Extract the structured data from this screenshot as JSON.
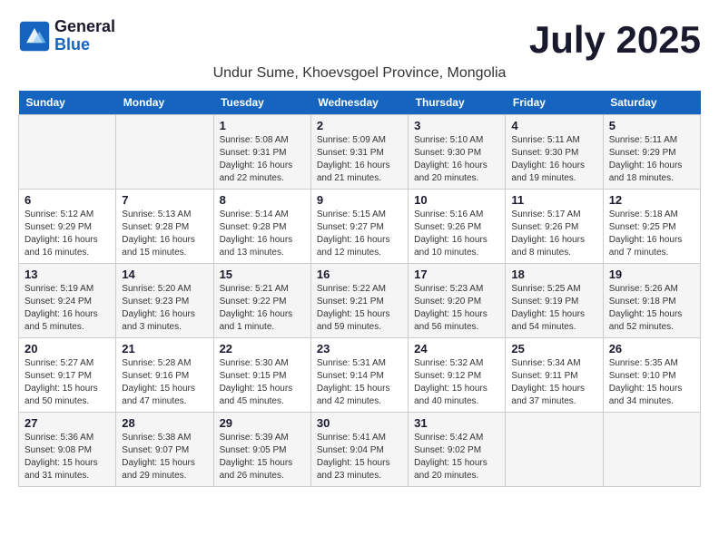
{
  "logo": {
    "line1": "General",
    "line2": "Blue"
  },
  "title": "July 2025",
  "subtitle": "Undur Sume, Khoevsgoel Province, Mongolia",
  "weekdays": [
    "Sunday",
    "Monday",
    "Tuesday",
    "Wednesday",
    "Thursday",
    "Friday",
    "Saturday"
  ],
  "weeks": [
    [
      {
        "day": "",
        "info": ""
      },
      {
        "day": "",
        "info": ""
      },
      {
        "day": "1",
        "info": "Sunrise: 5:08 AM\nSunset: 9:31 PM\nDaylight: 16 hours and 22 minutes."
      },
      {
        "day": "2",
        "info": "Sunrise: 5:09 AM\nSunset: 9:31 PM\nDaylight: 16 hours and 21 minutes."
      },
      {
        "day": "3",
        "info": "Sunrise: 5:10 AM\nSunset: 9:30 PM\nDaylight: 16 hours and 20 minutes."
      },
      {
        "day": "4",
        "info": "Sunrise: 5:11 AM\nSunset: 9:30 PM\nDaylight: 16 hours and 19 minutes."
      },
      {
        "day": "5",
        "info": "Sunrise: 5:11 AM\nSunset: 9:29 PM\nDaylight: 16 hours and 18 minutes."
      }
    ],
    [
      {
        "day": "6",
        "info": "Sunrise: 5:12 AM\nSunset: 9:29 PM\nDaylight: 16 hours and 16 minutes."
      },
      {
        "day": "7",
        "info": "Sunrise: 5:13 AM\nSunset: 9:28 PM\nDaylight: 16 hours and 15 minutes."
      },
      {
        "day": "8",
        "info": "Sunrise: 5:14 AM\nSunset: 9:28 PM\nDaylight: 16 hours and 13 minutes."
      },
      {
        "day": "9",
        "info": "Sunrise: 5:15 AM\nSunset: 9:27 PM\nDaylight: 16 hours and 12 minutes."
      },
      {
        "day": "10",
        "info": "Sunrise: 5:16 AM\nSunset: 9:26 PM\nDaylight: 16 hours and 10 minutes."
      },
      {
        "day": "11",
        "info": "Sunrise: 5:17 AM\nSunset: 9:26 PM\nDaylight: 16 hours and 8 minutes."
      },
      {
        "day": "12",
        "info": "Sunrise: 5:18 AM\nSunset: 9:25 PM\nDaylight: 16 hours and 7 minutes."
      }
    ],
    [
      {
        "day": "13",
        "info": "Sunrise: 5:19 AM\nSunset: 9:24 PM\nDaylight: 16 hours and 5 minutes."
      },
      {
        "day": "14",
        "info": "Sunrise: 5:20 AM\nSunset: 9:23 PM\nDaylight: 16 hours and 3 minutes."
      },
      {
        "day": "15",
        "info": "Sunrise: 5:21 AM\nSunset: 9:22 PM\nDaylight: 16 hours and 1 minute."
      },
      {
        "day": "16",
        "info": "Sunrise: 5:22 AM\nSunset: 9:21 PM\nDaylight: 15 hours and 59 minutes."
      },
      {
        "day": "17",
        "info": "Sunrise: 5:23 AM\nSunset: 9:20 PM\nDaylight: 15 hours and 56 minutes."
      },
      {
        "day": "18",
        "info": "Sunrise: 5:25 AM\nSunset: 9:19 PM\nDaylight: 15 hours and 54 minutes."
      },
      {
        "day": "19",
        "info": "Sunrise: 5:26 AM\nSunset: 9:18 PM\nDaylight: 15 hours and 52 minutes."
      }
    ],
    [
      {
        "day": "20",
        "info": "Sunrise: 5:27 AM\nSunset: 9:17 PM\nDaylight: 15 hours and 50 minutes."
      },
      {
        "day": "21",
        "info": "Sunrise: 5:28 AM\nSunset: 9:16 PM\nDaylight: 15 hours and 47 minutes."
      },
      {
        "day": "22",
        "info": "Sunrise: 5:30 AM\nSunset: 9:15 PM\nDaylight: 15 hours and 45 minutes."
      },
      {
        "day": "23",
        "info": "Sunrise: 5:31 AM\nSunset: 9:14 PM\nDaylight: 15 hours and 42 minutes."
      },
      {
        "day": "24",
        "info": "Sunrise: 5:32 AM\nSunset: 9:12 PM\nDaylight: 15 hours and 40 minutes."
      },
      {
        "day": "25",
        "info": "Sunrise: 5:34 AM\nSunset: 9:11 PM\nDaylight: 15 hours and 37 minutes."
      },
      {
        "day": "26",
        "info": "Sunrise: 5:35 AM\nSunset: 9:10 PM\nDaylight: 15 hours and 34 minutes."
      }
    ],
    [
      {
        "day": "27",
        "info": "Sunrise: 5:36 AM\nSunset: 9:08 PM\nDaylight: 15 hours and 31 minutes."
      },
      {
        "day": "28",
        "info": "Sunrise: 5:38 AM\nSunset: 9:07 PM\nDaylight: 15 hours and 29 minutes."
      },
      {
        "day": "29",
        "info": "Sunrise: 5:39 AM\nSunset: 9:05 PM\nDaylight: 15 hours and 26 minutes."
      },
      {
        "day": "30",
        "info": "Sunrise: 5:41 AM\nSunset: 9:04 PM\nDaylight: 15 hours and 23 minutes."
      },
      {
        "day": "31",
        "info": "Sunrise: 5:42 AM\nSunset: 9:02 PM\nDaylight: 15 hours and 20 minutes."
      },
      {
        "day": "",
        "info": ""
      },
      {
        "day": "",
        "info": ""
      }
    ]
  ]
}
